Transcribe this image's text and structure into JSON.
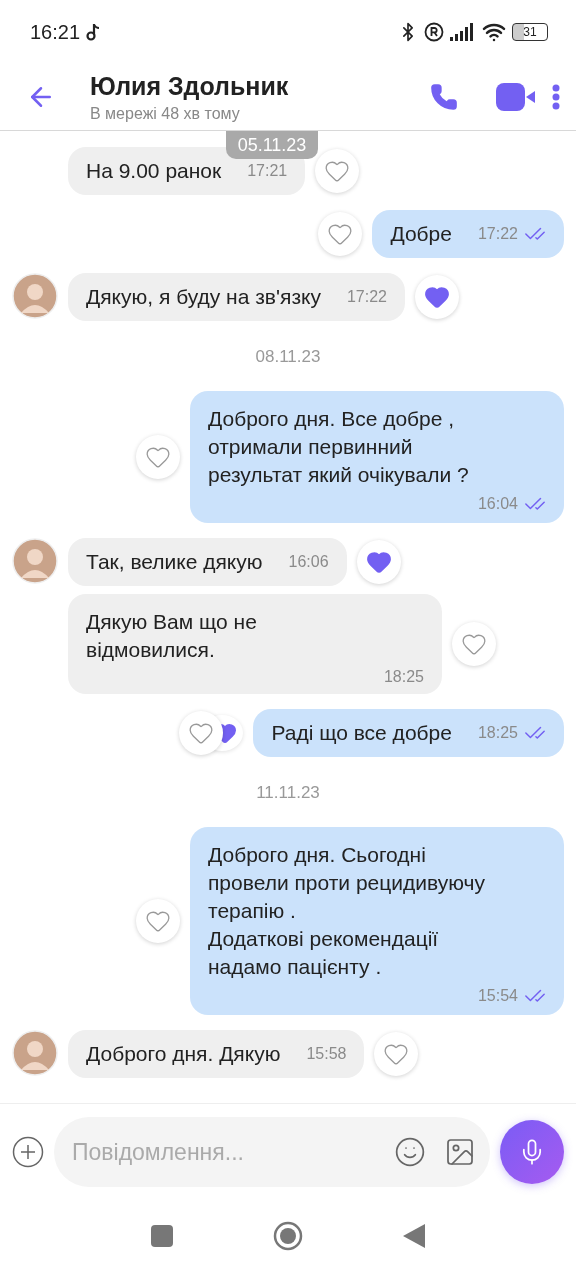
{
  "status_bar": {
    "time": "16:21",
    "battery": "31"
  },
  "header": {
    "name": "Юлия Здольник",
    "status": "В мережі 48 хв тому"
  },
  "floating_date": "05.11.23",
  "messages": [
    {
      "kind": "incoming",
      "avatar": false,
      "text": "На 9.00 ранок",
      "time": "17:21",
      "time_below": false,
      "liked": false
    },
    {
      "kind": "outgoing",
      "text": "Добре",
      "time": "17:22",
      "time_below": false,
      "liked": false,
      "reaction": false,
      "read": true
    },
    {
      "kind": "incoming",
      "avatar": true,
      "text": "Дякую, я буду на зв'язку",
      "time": "17:22",
      "time_below": false,
      "liked": true
    },
    {
      "kind": "date",
      "text": "08.11.23"
    },
    {
      "kind": "outgoing",
      "text": "Доброго дня. Все добре ,\nотримали первинний\nрезультат який очікували ?",
      "time": "16:04",
      "time_below": true,
      "liked": false,
      "reaction": false,
      "read": true
    },
    {
      "kind": "incoming",
      "avatar": true,
      "text": "Так, велике дякую",
      "time": "16:06",
      "time_below": false,
      "liked": true
    },
    {
      "kind": "incoming",
      "avatar": false,
      "text": "Дякую Вам що не\nвідмовилися.",
      "time": "18:25",
      "time_below": true,
      "liked": false
    },
    {
      "kind": "outgoing",
      "text": "Раді що все добре",
      "time": "18:25",
      "time_below": false,
      "liked": false,
      "reaction": true,
      "read": true
    },
    {
      "kind": "date",
      "text": "11.11.23"
    },
    {
      "kind": "outgoing",
      "text": "Доброго дня. Сьогодні\nпровели проти рецидивуючу\nтерапію .\nДодаткові рекомендації\nнадамо пацієнту .",
      "time": "15:54",
      "time_below": true,
      "liked": false,
      "reaction": false,
      "read": true
    },
    {
      "kind": "incoming",
      "avatar": true,
      "text": "Доброго дня. Дякую",
      "time": "15:58",
      "time_below": false,
      "liked": false
    }
  ],
  "composer": {
    "placeholder": "Повідомлення..."
  }
}
